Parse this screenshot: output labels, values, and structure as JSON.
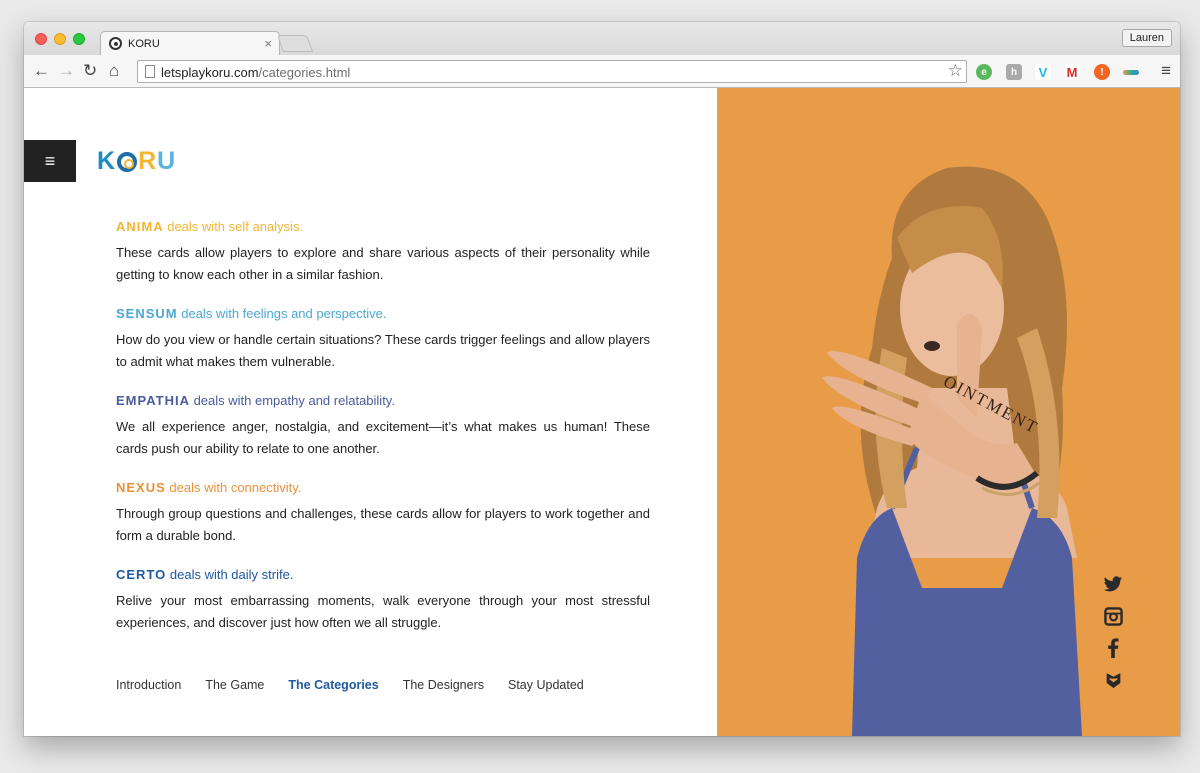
{
  "browser": {
    "tab_title": "KORU",
    "tab_close": "×",
    "profile_name": "Lauren",
    "url_host": "letsplaykoru.com",
    "url_path": "/categories.html",
    "extensions": [
      "evernote-icon",
      "hola-icon",
      "vimeo-icon",
      "gmail-icon",
      "alert-icon",
      "rainbow-icon"
    ]
  },
  "site": {
    "menu_glyph": "≡",
    "logo": {
      "k": "K",
      "r": "R",
      "u": "U"
    },
    "categories": [
      {
        "name": "ANIMA",
        "tagline": " deals with self analysis.",
        "color": "#f2b632",
        "body": "These cards allow players to explore and share various aspects of their personality while getting to know each other in a similar fashion."
      },
      {
        "name": "SENSUM",
        "tagline": " deals with feelings and perspective.",
        "color": "#4ba8d3",
        "body": "How do you view or handle certain situations? These cards trigger feelings and allow players to admit what makes them vulnerable."
      },
      {
        "name": "EMPATHIA",
        "tagline": " deals with empathy and relatability.",
        "color": "#4a5b9e",
        "body": "We all experience anger, nostalgia, and excitement—it’s what makes us human! These cards push our ability to relate to one another."
      },
      {
        "name": "NEXUS",
        "tagline": " deals with connectivity.",
        "color": "#e8923a",
        "body": "Through group questions and challenges, these cards allow for players to work together and form a durable bond."
      },
      {
        "name": "CERTO",
        "tagline": " deals with daily strife.",
        "color": "#1f5aa0",
        "body": "Relive your most embarrassing moments, walk everyone through your most stressful experiences, and discover just how often we all struggle."
      }
    ],
    "nav": [
      {
        "label": "Introduction",
        "active": false
      },
      {
        "label": "The Game",
        "active": false
      },
      {
        "label": "The Categories",
        "active": true
      },
      {
        "label": "The Designers",
        "active": false
      },
      {
        "label": "Stay Updated",
        "active": false
      }
    ],
    "photo_text": "OINTMENT",
    "social": [
      "twitter-icon",
      "instagram-icon",
      "facebook-icon",
      "bloglovin-icon"
    ],
    "accent_bg": "#e99c47"
  }
}
